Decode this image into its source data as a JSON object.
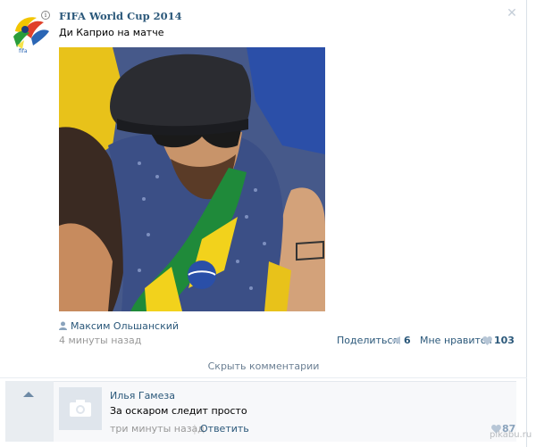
{
  "post": {
    "author": "FIFA World Cup 2014",
    "text": "Ди Каприо на матче",
    "signer": "Максим Ольшанский",
    "time": "4 минуты назад",
    "share_label": "Поделиться",
    "share_count": "6",
    "like_label": "Мне нравится",
    "like_count": "103"
  },
  "comments": {
    "hide_label": "Скрыть комментарии",
    "items": [
      {
        "author": "Илья Гамеза",
        "text": "За оскаром следит просто",
        "time": "три минуты назад",
        "separator": "|",
        "reply_label": "Ответить",
        "like_count": "87"
      }
    ]
  },
  "icons": {
    "avatar": "fifa-brazil-logo-icon",
    "info": "info-icon",
    "close": "close-icon",
    "signer": "user-icon",
    "share": "megaphone-icon",
    "like": "heart-icon",
    "scroll_up": "arrow-up-icon",
    "comment_avatar": "camera-icon"
  },
  "colors": {
    "link": "#2b587a",
    "muted": "#999999",
    "hide_text": "#6b7f93",
    "panel": "#e9edf1"
  },
  "watermark": "pikabu.ru",
  "info_glyph": "i",
  "close_glyph": "✕"
}
